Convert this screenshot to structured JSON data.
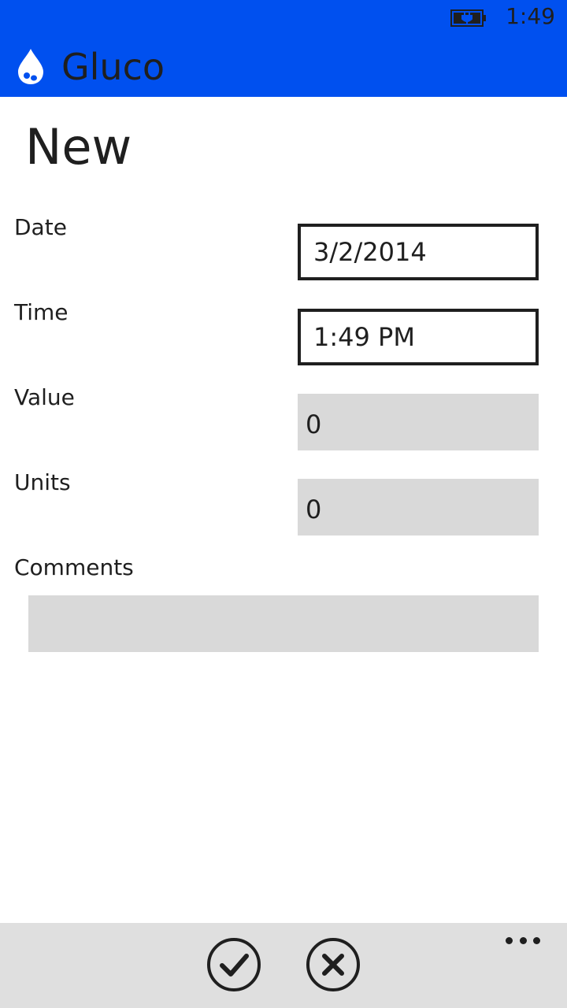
{
  "status_bar": {
    "time": "1:49",
    "battery_icon": "battery-charging-icon"
  },
  "header": {
    "app_title": "Gluco",
    "logo_icon": "water-drop-icon",
    "bg_color": "#0050ef"
  },
  "page": {
    "title": "New"
  },
  "form": {
    "date": {
      "label": "Date",
      "value": "3/2/2014"
    },
    "time": {
      "label": "Time",
      "value": "1:49 PM"
    },
    "value": {
      "label": "Value",
      "value": "0"
    },
    "units": {
      "label": "Units",
      "value": "0"
    },
    "comments": {
      "label": "Comments",
      "value": ""
    }
  },
  "app_bar": {
    "buttons": [
      {
        "icon": "check-icon"
      },
      {
        "icon": "close-icon"
      }
    ],
    "more_icon": "ellipsis-icon"
  }
}
